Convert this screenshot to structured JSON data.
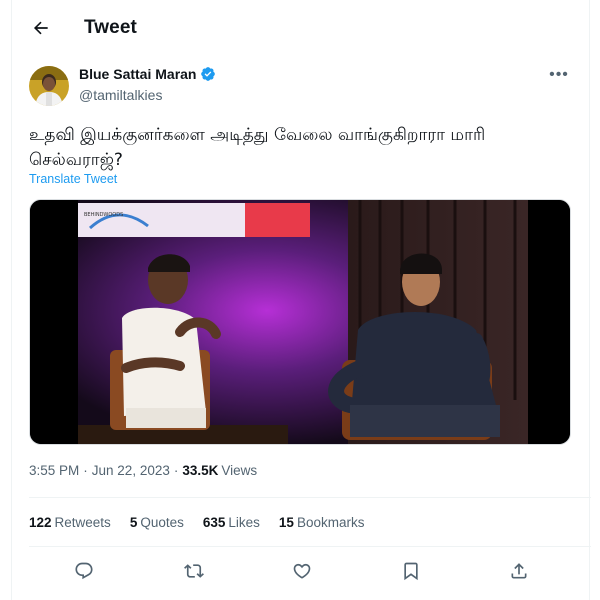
{
  "header": {
    "title": "Tweet",
    "back_icon": "arrow-left-icon"
  },
  "author": {
    "name": "Blue Sattai Maran",
    "handle": "@tamiltalkies",
    "verified": true,
    "verified_color": "#1d9bf0"
  },
  "tweet": {
    "text_line1": "உதவி இயக்குனர்களை அடித்து வேலை வாங்குகிறாரா மாரி",
    "text_line2": "செல்வராஜ்?",
    "translate_label": "Translate Tweet"
  },
  "media": {
    "type": "video-still",
    "sign_text": "BEHINDWOODS"
  },
  "meta": {
    "time": "3:55 PM",
    "separator": "·",
    "date": "Jun 22, 2023",
    "views_count": "33.5K",
    "views_label": "Views"
  },
  "stats": [
    {
      "count": "122",
      "label": "Retweets"
    },
    {
      "count": "5",
      "label": "Quotes"
    },
    {
      "count": "635",
      "label": "Likes"
    },
    {
      "count": "15",
      "label": "Bookmarks"
    }
  ],
  "actions": [
    "reply-icon",
    "retweet-icon",
    "like-icon",
    "bookmark-icon",
    "share-icon"
  ],
  "colors": {
    "accent": "#1d9bf0",
    "text_primary": "#0f1419",
    "text_secondary": "#536471",
    "border": "#eff3f4"
  }
}
